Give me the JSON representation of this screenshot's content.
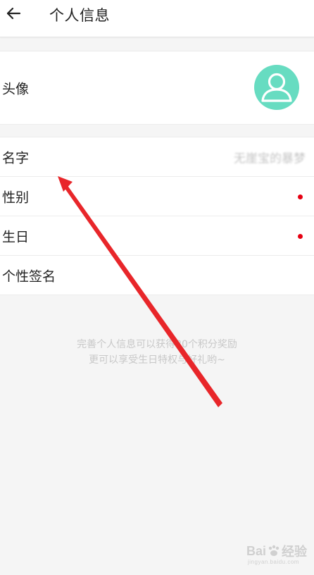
{
  "header": {
    "back_icon": "arrow-left-icon",
    "title": "个人信息"
  },
  "profile": {
    "avatar": {
      "label": "头像",
      "icon": "user-avatar-icon",
      "color": "#67dcc1"
    },
    "name": {
      "label": "名字",
      "value": "无崖宝的暴梦"
    },
    "gender": {
      "label": "性别",
      "indicator_color": "#e60012"
    },
    "birthday": {
      "label": "生日",
      "indicator_color": "#e60012"
    },
    "signature": {
      "label": "个性签名"
    }
  },
  "hint": {
    "line1": "完善个人信息可以获得20个积分奖励",
    "line2": "更可以享受生日特权与好礼哟~"
  },
  "annotation": {
    "type": "red-arrow",
    "color": "#e8262a"
  },
  "watermark": {
    "brand_prefix": "Bai",
    "brand_suffix": "经验",
    "url": "jingyan.baidu.com"
  }
}
